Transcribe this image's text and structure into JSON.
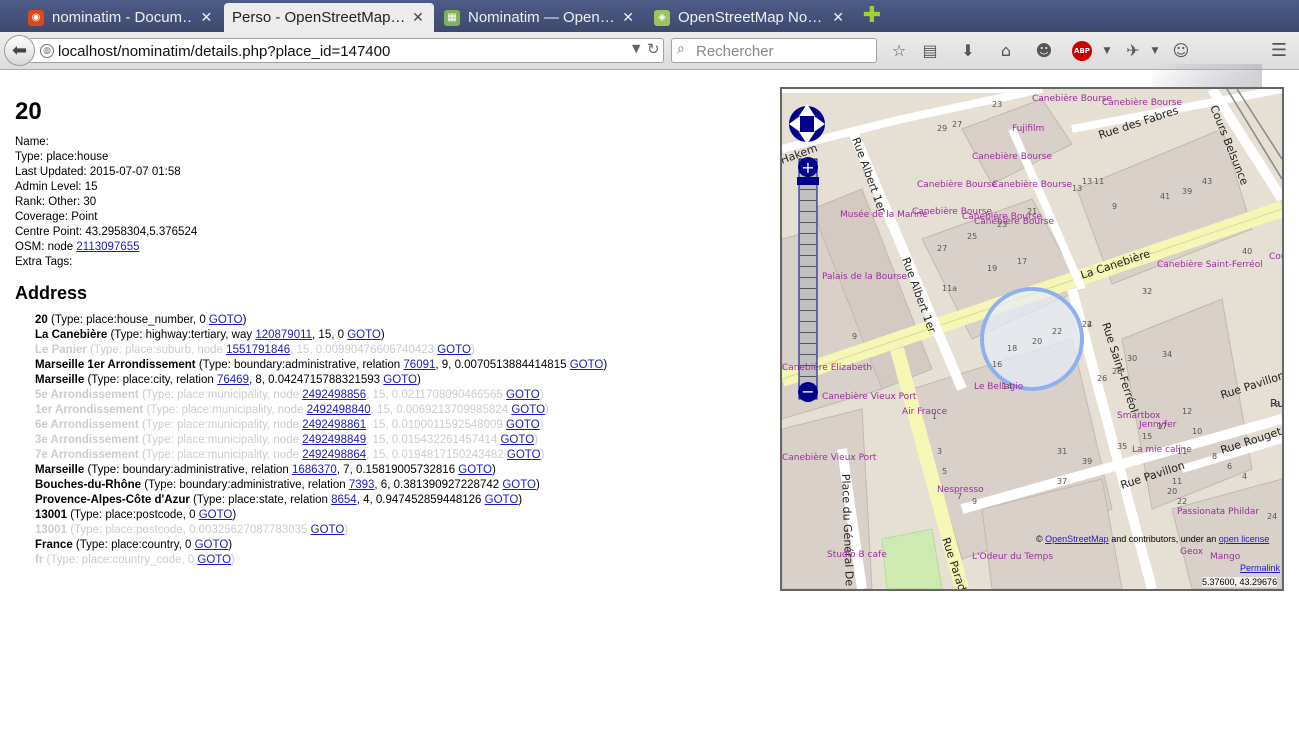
{
  "browser": {
    "tabs": [
      {
        "label": "nominatim - Docum…",
        "favicon": "ubuntu-icon",
        "active": false
      },
      {
        "label": "Perso - OpenStreetMap…",
        "favicon": "none",
        "active": true
      },
      {
        "label": "Nominatim — Open…",
        "favicon": "map-icon",
        "active": false
      },
      {
        "label": "OpenStreetMap No…",
        "favicon": "osm-icon",
        "active": false
      }
    ],
    "url": "localhost/nominatim/details.php?place_id=147400",
    "search_placeholder": "Rechercher",
    "abp_label": "ABP"
  },
  "place": {
    "title": "20",
    "fields": [
      {
        "label": "Name:",
        "value": ""
      },
      {
        "label": "Type:",
        "value": "place:house"
      },
      {
        "label": "Last Updated:",
        "value": "2015-07-07 01:58"
      },
      {
        "label": "Admin Level:",
        "value": "15"
      },
      {
        "label": "Rank:",
        "value": "Other: 30"
      },
      {
        "label": "Coverage:",
        "value": "Point"
      },
      {
        "label": "Centre Point:",
        "value": "43.2958304,5.376524"
      }
    ],
    "osm_prefix": "OSM: node",
    "osm_link": "2113097655",
    "extra_tags": "Extra Tags:"
  },
  "address": {
    "heading": "Address",
    "goto": "GOTO",
    "lines": [
      {
        "name": "20",
        "pre": "(Type: place:house_number, 0",
        "link": "",
        "post": "",
        "faded": false
      },
      {
        "name": "La Canebière",
        "pre": "(Type: highway:tertiary, way",
        "link": "120879011",
        "post": ", 15, 0",
        "faded": false
      },
      {
        "name": "Le Panier",
        "pre": "(Type: place:suburb, node",
        "link": "1551791846",
        "post": ", 15, 0.00990476606740423",
        "faded": true
      },
      {
        "name": "Marseille 1er Arrondissement",
        "pre": "(Type: boundary:administrative, relation",
        "link": "76091",
        "post": ", 9, 0.0070513884414815",
        "faded": false
      },
      {
        "name": "Marseille",
        "pre": "(Type: place:city, relation",
        "link": "76469",
        "post": ", 8, 0.0424715788321593",
        "faded": false
      },
      {
        "name": "5e Arrondissement",
        "pre": "(Type: place:municipality, node",
        "link": "2492498856",
        "post": ", 15, 0.0211708090466565",
        "faded": true
      },
      {
        "name": "1er Arrondissement",
        "pre": "(Type: place:municipality, node",
        "link": "2492498840",
        "post": ", 15, 0.0069213709985824",
        "faded": true
      },
      {
        "name": "6e Arrondissement",
        "pre": "(Type: place:municipality, node",
        "link": "2492498861",
        "post": ", 15, 0.0100011592548009",
        "faded": true
      },
      {
        "name": "3e Arrondissement",
        "pre": "(Type: place:municipality, node",
        "link": "2492498849",
        "post": ", 15, 0.015432261457414",
        "faded": true
      },
      {
        "name": "7e Arrondissement",
        "pre": "(Type: place:municipality, node",
        "link": "2492498864",
        "post": ", 15, 0.0194817150243482",
        "faded": true
      },
      {
        "name": "Marseille",
        "pre": "(Type: boundary:administrative, relation",
        "link": "1686370",
        "post": ", 7, 0.15819005732816",
        "faded": false
      },
      {
        "name": "Bouches-du-Rhône",
        "pre": "(Type: boundary:administrative, relation",
        "link": "7393",
        "post": ", 6, 0.381390927228742",
        "faded": false
      },
      {
        "name": "Provence-Alpes-Côte d'Azur",
        "pre": "(Type: place:state, relation",
        "link": "8654",
        "post": ", 4, 0.947452859448126",
        "faded": false
      },
      {
        "name": "13001",
        "pre": "(Type: place:postcode, 0",
        "link": "",
        "post": "",
        "faded": false
      },
      {
        "name": "13001",
        "pre": "(Type: place:postcode, 0.00325627087783035",
        "link": "",
        "post": "",
        "faded": true
      },
      {
        "name": "France",
        "pre": "(Type: place:country, 0",
        "link": "",
        "post": "",
        "faded": false
      },
      {
        "name": "fr",
        "pre": "(Type: place:country_code, 0",
        "link": "",
        "post": "",
        "faded": true
      }
    ]
  },
  "map": {
    "streets": [
      "Rue Albert 1er",
      "Rue Albert 1er",
      "La Canebière",
      "Rue Saint-Ferréol",
      "Rue Pavillon",
      "Rue Pavillon",
      "Rue Paradis",
      "Place du Général De Gaulle",
      "Rue des Fabres",
      "Cours Belsunce",
      "Rue Rouget",
      "Rue",
      "Hakem"
    ],
    "pois": [
      "Fujifilm",
      "Canebière Bourse",
      "Canebière Bourse",
      "Canebière Bourse",
      "Canebière Bourse",
      "Canebière Bourse",
      "Canebière Bourse",
      "Canebière Bourse",
      "Canebière Bourse",
      "Musée de la Marine",
      "Palais de la Bourse",
      "Canebière Saint-Ferréol",
      "Le Bellagio",
      "Air France",
      "Smartbox",
      "Jennyfer",
      "La mie caline",
      "Nespresso",
      "Passionata Phildar",
      "Geox",
      "Mango",
      "L'Odeur du Temps",
      "Studio B cafe",
      "Canebière Vieux Port",
      "Canebière Elizabeth",
      "Canebière Vieux Port",
      "Cou",
      "La"
    ],
    "house_numbers": [
      "23",
      "29",
      "27",
      "21",
      "23",
      "27",
      "25",
      "19",
      "17",
      "11a",
      "9",
      "13",
      "11",
      "9",
      "43",
      "39",
      "41",
      "40",
      "32",
      "34",
      "30",
      "28",
      "26",
      "24",
      "22",
      "20",
      "18",
      "16",
      "14",
      "12",
      "11",
      "10",
      "8",
      "6",
      "4",
      "2",
      "1",
      "3",
      "5",
      "7",
      "9",
      "17",
      "15",
      "11",
      "31",
      "37",
      "39",
      "35",
      "20",
      "22",
      "24",
      "13"
    ],
    "attribution_prefix": "© ",
    "attribution_link": "OpenStreetMap",
    "attribution_mid": " and contributors, under an ",
    "attribution_link2": "open license",
    "permalink": "Permalink",
    "coords": "5.37600, 43.29676"
  }
}
